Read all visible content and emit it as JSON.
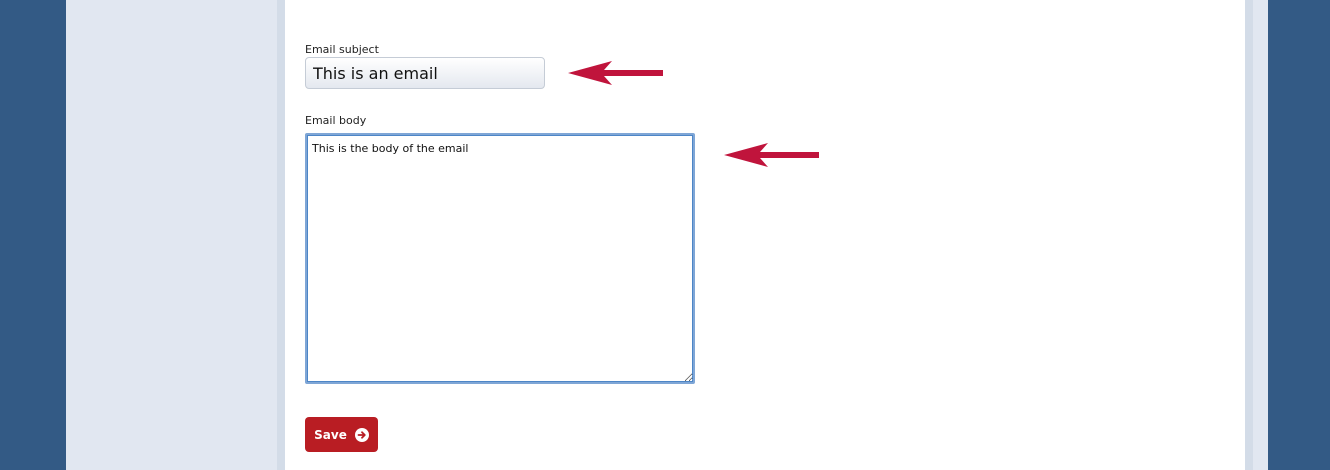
{
  "form": {
    "subject_label": "Email subject",
    "subject_value": "This is an email",
    "body_label": "Email body",
    "body_value": "This is the body of the email",
    "save_label": "Save",
    "save_icon": "arrow-right-circle-icon"
  },
  "colors": {
    "page_background": "#335a85",
    "side_panel": "#e1e7f1",
    "content_background": "#ffffff",
    "save_button": "#b91d23",
    "annotation_arrow": "#c0143c",
    "textarea_focus_border": "#4d86c7"
  },
  "annotations": {
    "arrow_icon": "left-arrow-icon"
  }
}
